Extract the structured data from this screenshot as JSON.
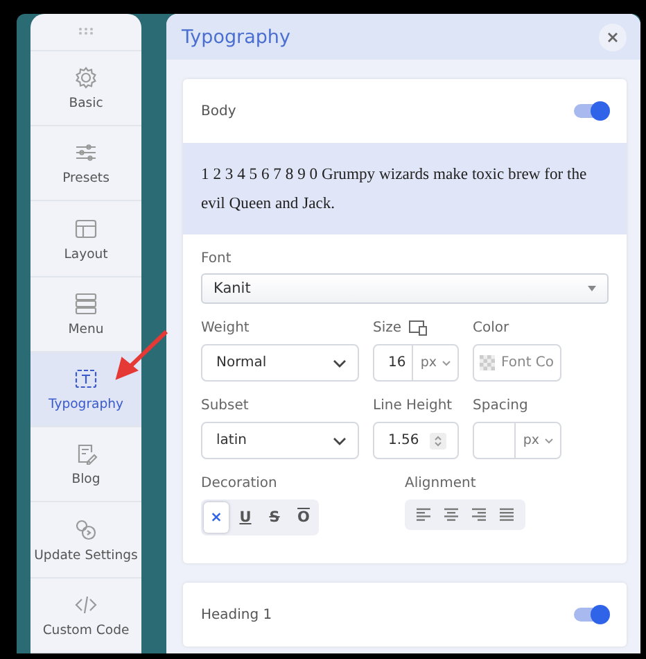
{
  "sidebar": {
    "items": [
      {
        "label": "Basic",
        "selected": false
      },
      {
        "label": "Presets",
        "selected": false
      },
      {
        "label": "Layout",
        "selected": false
      },
      {
        "label": "Menu",
        "selected": false
      },
      {
        "label": "Typography",
        "selected": true
      },
      {
        "label": "Blog",
        "selected": false
      },
      {
        "label": "Update Settings",
        "selected": false
      },
      {
        "label": "Custom Code",
        "selected": false
      }
    ]
  },
  "panel": {
    "title": "Typography",
    "body": {
      "title": "Body",
      "on": true,
      "preview": "1 2 3 4 5 6 7 8 9 0 Grumpy wizards make toxic brew for the evil Queen and Jack.",
      "font": {
        "label": "Font",
        "value": "Kanit"
      },
      "weight": {
        "label": "Weight",
        "value": "Normal"
      },
      "size": {
        "label": "Size",
        "value": "16",
        "unit": "px"
      },
      "color": {
        "label": "Color",
        "placeholder": "Font Co"
      },
      "subset": {
        "label": "Subset",
        "value": "latin"
      },
      "line_height": {
        "label": "Line Height",
        "value": "1.56"
      },
      "spacing": {
        "label": "Spacing",
        "unit": "px"
      },
      "decoration": {
        "label": "Decoration",
        "options": [
          {
            "kind": "none",
            "label": "×",
            "selected": true
          },
          {
            "kind": "underline",
            "label": "U",
            "selected": false
          },
          {
            "kind": "line-through",
            "label": "S",
            "selected": false
          },
          {
            "kind": "overline",
            "label": "O",
            "selected": false
          }
        ]
      },
      "alignment": {
        "label": "Alignment",
        "options": [
          {
            "kind": "left"
          },
          {
            "kind": "center"
          },
          {
            "kind": "right"
          },
          {
            "kind": "justify"
          }
        ]
      }
    },
    "heading": {
      "title": "Heading 1",
      "on": true
    }
  }
}
